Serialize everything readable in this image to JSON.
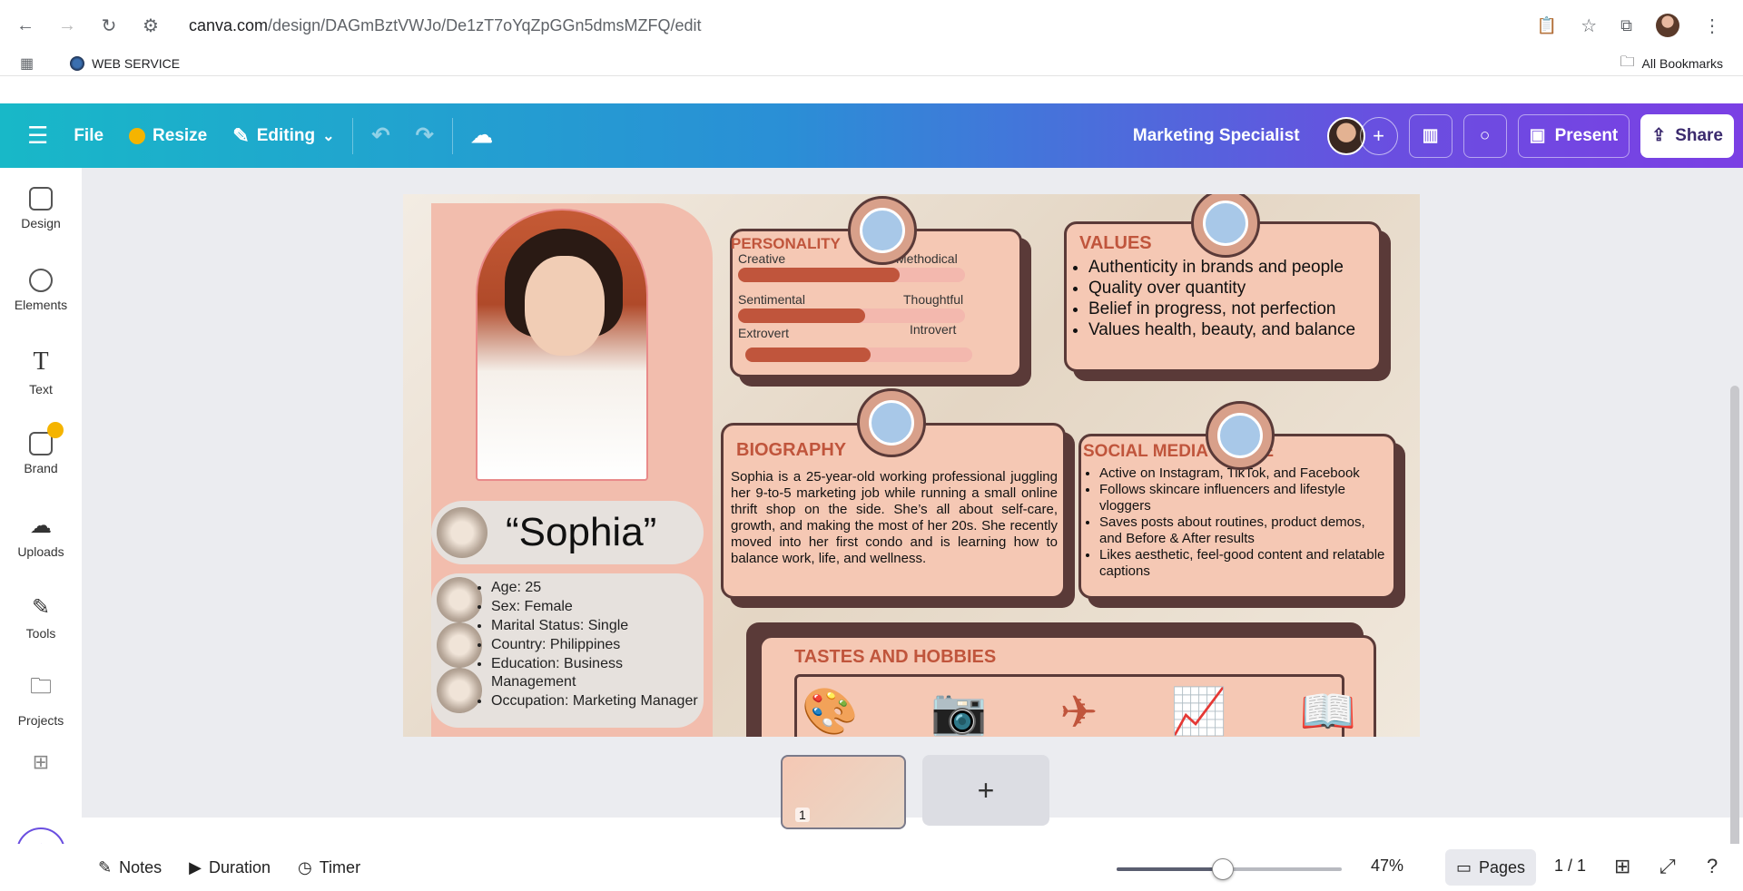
{
  "browser": {
    "url_host": "canva.com",
    "url_path": "/design/DAGmBztVWJo/De1zT7oYqZpGGn5dmsMZFQ/edit",
    "bookmark_label": "WEB SERVICE",
    "all_bookmarks_label": "All Bookmarks"
  },
  "toolbar": {
    "file_label": "File",
    "resize_label": "Resize",
    "editing_label": "Editing",
    "doc_title": "Marketing Specialist",
    "present_label": "Present",
    "share_label": "Share"
  },
  "sidebar": {
    "items": [
      {
        "label": "Design",
        "icon": "design-icon"
      },
      {
        "label": "Elements",
        "icon": "elements-icon"
      },
      {
        "label": "Text",
        "icon": "text-icon"
      },
      {
        "label": "Brand",
        "icon": "brand-icon"
      },
      {
        "label": "Uploads",
        "icon": "uploads-icon"
      },
      {
        "label": "Tools",
        "icon": "tools-icon"
      },
      {
        "label": "Projects",
        "icon": "projects-icon"
      }
    ]
  },
  "design": {
    "name": "“Sophia”",
    "info": [
      "Age: 25",
      "Sex: Female",
      "Marital Status: Single",
      "Country: Philippines",
      "Education: Business Management",
      "Occupation: Marketing Manager"
    ],
    "personality": {
      "title": "PERSONALITY",
      "traits": [
        {
          "left": "Creative",
          "right": "Methodical",
          "level": 0.7
        },
        {
          "left": "Sentimental",
          "right": "Thoughtful",
          "level": 0.55
        },
        {
          "left": "Extrovert",
          "right": "Introvert",
          "level": 0.55
        }
      ]
    },
    "values": {
      "title": "VALUES",
      "items": [
        "Authenticity in brands and people",
        "Quality over quantity",
        "Belief in progress, not perfection",
        "Values health, beauty, and balance"
      ]
    },
    "biography": {
      "title": "BIOGRAPHY",
      "text": "Sophia is a 25-year-old working professional juggling her 9-to-5 marketing job while running a small online thrift shop on the side. She’s all about self-care, growth, and making the most of her 20s. She recently moved into her first condo and is learning how to balance work, life, and wellness."
    },
    "social": {
      "title": "SOCIAL MEDIA USAGE",
      "items": [
        "Active on Instagram, TikTok, and Facebook",
        "Follows skincare influencers and lifestyle vloggers",
        "Saves posts about routines, product demos, and Before & After results",
        "Likes aesthetic, feel-good content and relatable captions"
      ]
    },
    "hobbies": {
      "title": "TASTES AND HOBBIES",
      "icons": [
        "palette-icon",
        "camera-icon",
        "airplane-icon",
        "chart-icon",
        "book-icon"
      ]
    }
  },
  "pages": {
    "thumb_number": "1"
  },
  "bottom": {
    "notes_label": "Notes",
    "duration_label": "Duration",
    "timer_label": "Timer",
    "zoom_level": 0.47,
    "zoom_label": "47%",
    "pages_label": "Pages",
    "page_count": "1 / 1"
  },
  "colors": {
    "accent": "#c0553c",
    "card_bg": "#f5c8b4",
    "card_border": "#5a3a38",
    "toolbar_start": "#18b8c8",
    "toolbar_end": "#7b3fe4"
  }
}
